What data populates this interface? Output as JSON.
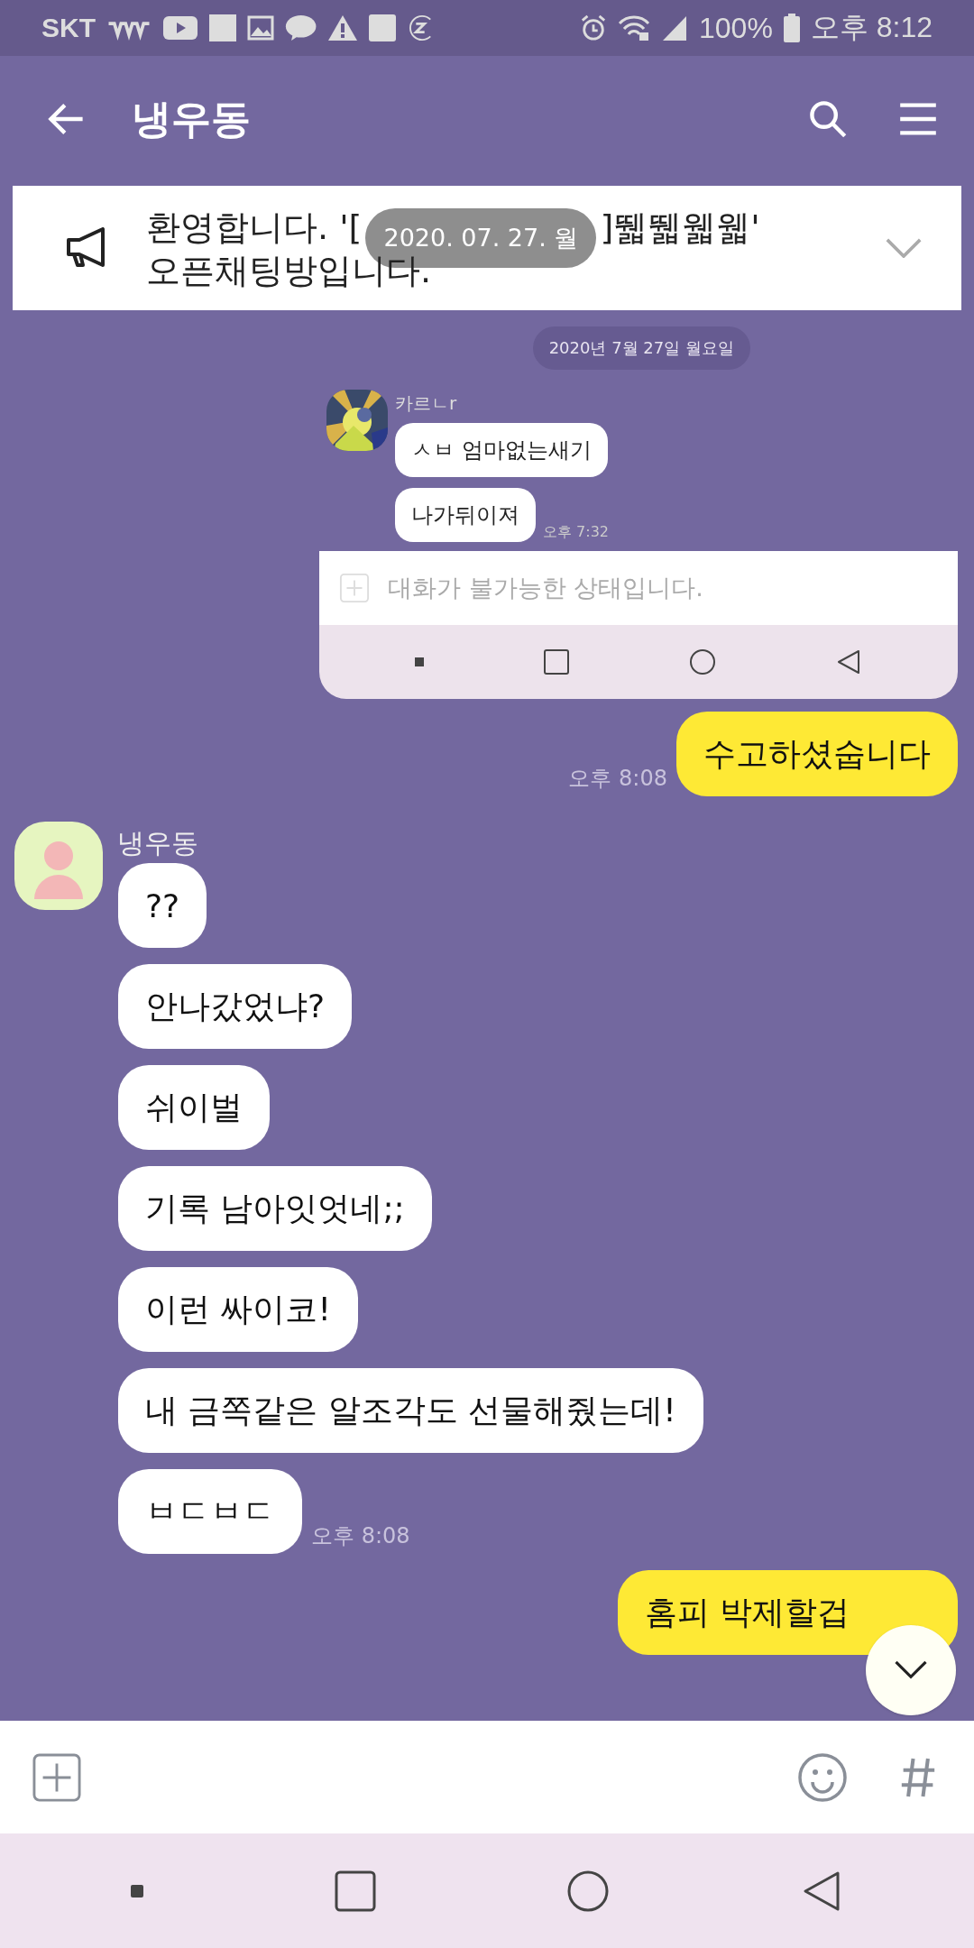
{
  "status_bar": {
    "carrier": "SKT",
    "battery": "100%",
    "time": "오후 8:12"
  },
  "header": {
    "title": "냉우동"
  },
  "notice": {
    "first_line": [
      "환영합니다. '[",
      "]뛟뛟웳웳'"
    ],
    "second_line": "오픈채팅방입니다.",
    "expanded": false
  },
  "date_toast": "2020. 07. 27. 월",
  "shared_screenshot": {
    "date_divider": "2020년 7월 27일 월요일",
    "sender": "카르ㄴr",
    "messages": [
      "ㅅㅂ 엄마없는새기",
      "나가뒤이져"
    ],
    "time": "오후 7:32",
    "input_placeholder": "대화가 불가능한 상태입니다."
  },
  "messages": [
    {
      "kind": "out",
      "text": "수고하셨숩니다",
      "time": "오후 8:08"
    },
    {
      "kind": "sender",
      "text": "냉우동"
    },
    {
      "kind": "in",
      "text": "??"
    },
    {
      "kind": "in",
      "text": "안나갔었냐?"
    },
    {
      "kind": "in",
      "text": "쉬이벌"
    },
    {
      "kind": "in",
      "text": "기록 남아잇엇네;;"
    },
    {
      "kind": "in",
      "text": "이런 싸이코!"
    },
    {
      "kind": "in",
      "text": "내 금쪽같은 알조각도 선물해줬는데!"
    },
    {
      "kind": "in",
      "text": "ㅂㄷㅂㄷ",
      "time": "오후 8:08"
    },
    {
      "kind": "out",
      "text": "홈피 박제할겁"
    }
  ]
}
